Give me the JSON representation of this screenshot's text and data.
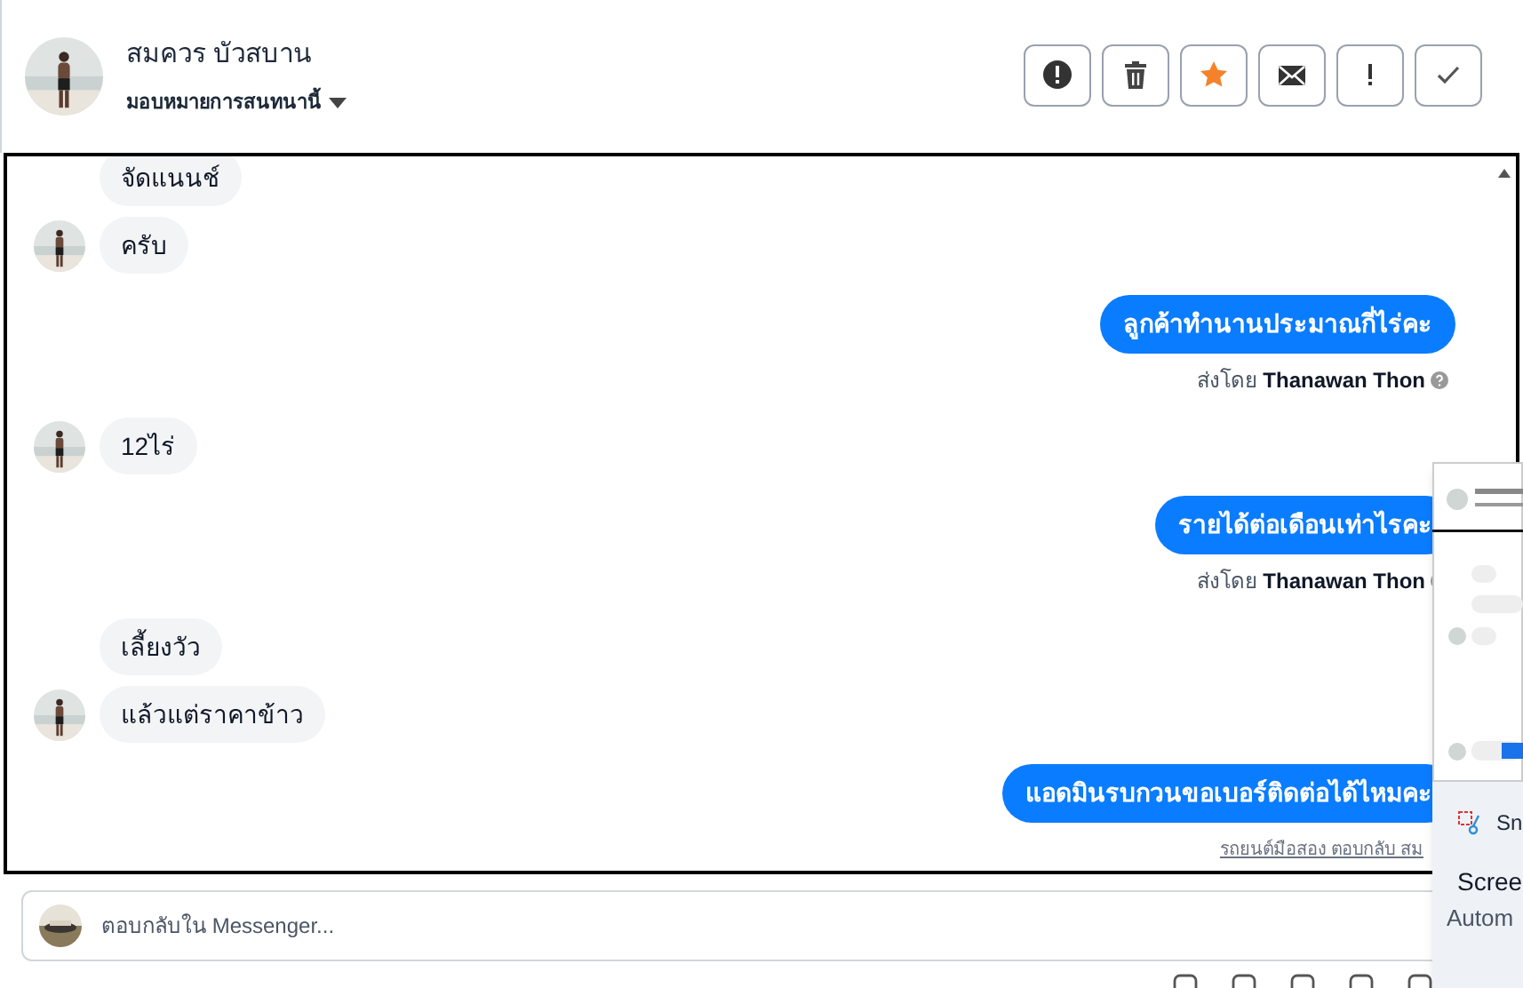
{
  "header": {
    "contact_name": "สมควร บัวสบาน",
    "assign_label": "มอบหมายการสนทนานี้",
    "actions": [
      {
        "kind": "alert"
      },
      {
        "kind": "trash"
      },
      {
        "kind": "star",
        "selected": true
      },
      {
        "kind": "mail"
      },
      {
        "kind": "important"
      },
      {
        "kind": "check"
      }
    ]
  },
  "conversation": [
    {
      "kind": "incoming",
      "messages": [
        {
          "text": "จัดแนนช์",
          "avatar": false
        },
        {
          "text": "ครับ",
          "avatar": true
        }
      ]
    },
    {
      "kind": "outgoing",
      "messages": [
        {
          "text": "ลูกค้าทำนานประมาณกี่ไร่คะ"
        }
      ],
      "sent_by_prefix": "ส่งโดย",
      "sent_by": "Thanawan Thon"
    },
    {
      "kind": "incoming",
      "messages": [
        {
          "text": "12ไร่",
          "avatar": true
        }
      ]
    },
    {
      "kind": "outgoing",
      "messages": [
        {
          "text": "รายได้ต่อเดือนเท่าไรคะ"
        }
      ],
      "sent_by_prefix": "ส่งโดย",
      "sent_by": "Thanawan Thon"
    },
    {
      "kind": "incoming",
      "messages": [
        {
          "text": "เลี้ยงวัว",
          "avatar": false
        },
        {
          "text": "แล้วแต่ราคาข้าว",
          "avatar": true
        }
      ]
    },
    {
      "kind": "outgoing",
      "messages": [
        {
          "text": "แอดมินรบกวนขอเบอร์ติดต่อได้ไหมคะ"
        }
      ]
    }
  ],
  "reply_note": "รถยนต์มือสอง ตอบกลับ สม",
  "composer": {
    "placeholder": "ตอบกลับใน Messenger..."
  },
  "notification": {
    "app": "Sn",
    "title": "Scree",
    "subtitle": "Autom"
  }
}
